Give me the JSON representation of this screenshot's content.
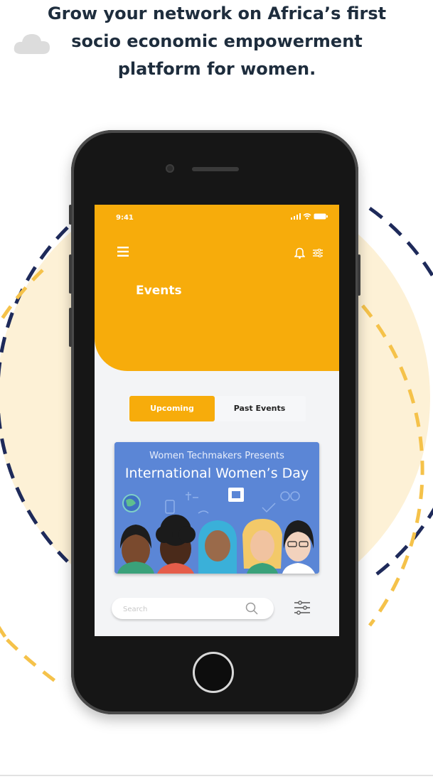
{
  "promo": {
    "headline_line1": "Grow your network on Africa’s first",
    "headline_line2": "socio economic empowerment",
    "headline_line3": "platform for women."
  },
  "colors": {
    "accent": "#f7ac0b",
    "navy": "#1e2a5a",
    "cream": "#fdf1d6",
    "headline": "#1e2d3d"
  },
  "status_bar": {
    "time": "9:41",
    "icons": [
      "signal-icon",
      "wifi-icon",
      "battery-icon"
    ]
  },
  "header": {
    "menu_icon": "hamburger-menu-icon",
    "actions": [
      "bell-icon",
      "filter-sliders-icon"
    ],
    "title": "Events"
  },
  "tabs": [
    {
      "label": "Upcoming",
      "active": true
    },
    {
      "label": "Past Events",
      "active": false
    }
  ],
  "event_card": {
    "subtitle": "Women Techmakers Presents",
    "title": "International Women’s Day"
  },
  "search": {
    "placeholder": "Search",
    "value": "",
    "icon": "search-icon",
    "filter_icon": "sort-sliders-icon"
  }
}
